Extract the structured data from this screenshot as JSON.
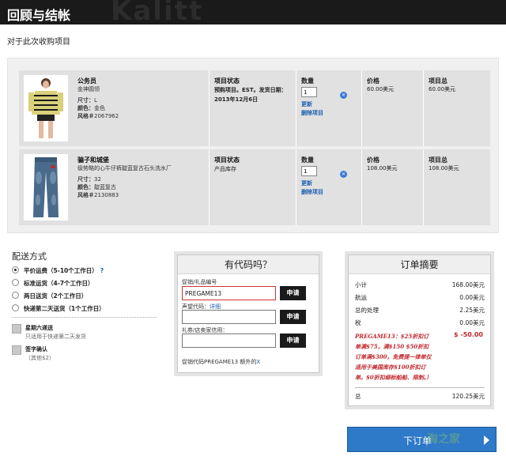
{
  "header": {
    "title": "回顾与结帐",
    "bg_word": "Kalitt"
  },
  "subtitle": "对于此次收购项目",
  "items": [
    {
      "name": "公务员",
      "sub": "金神圆领",
      "size_label": "尺寸：",
      "size": "L",
      "color_label": "颜色：",
      "color": "金色",
      "style_label": "风格＃",
      "style": "2067962",
      "status_header": "项目状态",
      "status": "预购项目。EST。发货日期：2013年12月6日",
      "qty_header": "数量",
      "qty": "1",
      "update": "更新",
      "remove": "删除项目",
      "price_header": "价格",
      "price": "60.00美元",
      "total_header": "项目总",
      "total": "60.00美元"
    },
    {
      "name": "骗子和城堡",
      "sub": "级势略的心牛仔裤靛蓝复古石头洗水厂",
      "size_label": "尺寸：",
      "size": "32",
      "color_label": "颜色：",
      "color": "靛蓝复古",
      "style_label": "风格＃",
      "style": "2130883",
      "status_header": "项目状态",
      "status": "产品库存",
      "qty_header": "数量",
      "qty": "1",
      "update": "更新",
      "remove": "删除项目",
      "price_header": "价格",
      "price": "108.00美元",
      "total_header": "项目总",
      "total": "108.00美元"
    }
  ],
  "shipping": {
    "title": "配送方式",
    "options": [
      "平价运费（5-10个工作日）",
      "标准运货（4-7个工作日）",
      "两日送货（2个工作日）",
      "快递第二天送货（1个工作日）"
    ],
    "help": "?",
    "saturday": "星期六递送",
    "saturday_sub": "只适用于快递第二天发货",
    "signature": "签字确认",
    "signature_sub": "（其他$2）"
  },
  "promo": {
    "title": "有代码吗？",
    "promo_label": "促销/礼品编号",
    "promo_value": "PREGAME13",
    "apply": "申请",
    "voice_label": "声望代码：",
    "voice_link": "详细",
    "gift_label": "礼券/店卖家信用：",
    "note": "促销代码PREGAME13 额外的",
    "note_x": "X"
  },
  "summary": {
    "title": "订单摘要",
    "rows": [
      {
        "label": "小计",
        "value": "168.00美元"
      },
      {
        "label": "航运",
        "value": "0.00美元"
      },
      {
        "label": "总的处理",
        "value": "2.25美元"
      },
      {
        "label": "税",
        "value": "0.00美元"
      }
    ],
    "discount_text": "PREGAME13：$25折扣订单满$75，满$150 $50折扣订单满$300，免费提一律单仅适用于美国库存$100折扣订单。$0折扣细标船船、限制。）",
    "discount_value": "$ -50.00",
    "total_label": "总",
    "total_value": "120.25美元"
  },
  "order_button": "下订单",
  "watermark": "淘之家"
}
